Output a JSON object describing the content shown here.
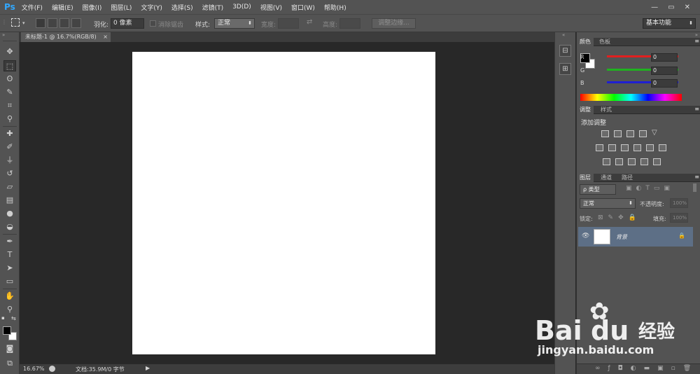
{
  "app": {
    "logo": "Ps"
  },
  "menu": [
    "文件(F)",
    "编辑(E)",
    "图像(I)",
    "图层(L)",
    "文字(Y)",
    "选择(S)",
    "滤镜(T)",
    "3D(D)",
    "视图(V)",
    "窗口(W)",
    "帮助(H)"
  ],
  "window_controls": {
    "minimize": "—",
    "restore": "▭",
    "close": "✕"
  },
  "options": {
    "feather_label": "羽化:",
    "feather_value": "0 像素",
    "antialias_label": "消除锯齿",
    "style_label": "样式:",
    "style_value": "正常",
    "width_label": "宽度:",
    "height_label": "高度:",
    "refine_edge": "调整边缘...",
    "workspace": "基本功能"
  },
  "document": {
    "tab_title": "未标题-1 @ 16.7%(RGB/8)",
    "close": "×"
  },
  "status": {
    "zoom": "16.67%",
    "doc_info": "文档:35.9M/0 字节"
  },
  "color_panel": {
    "tabs": [
      "颜色",
      "色板"
    ],
    "channels": [
      {
        "label": "R",
        "value": "0",
        "color": "#e21f1f"
      },
      {
        "label": "G",
        "value": "0",
        "color": "#1fb21f"
      },
      {
        "label": "B",
        "value": "0",
        "color": "#1f1fd2"
      }
    ],
    "foreground": "#000000",
    "background": "#ffffff"
  },
  "adjustments_panel": {
    "tabs": [
      "调整",
      "样式"
    ],
    "title": "添加调整"
  },
  "layers_panel": {
    "tabs": [
      "图层",
      "通道",
      "路径"
    ],
    "filter_kind": "ρ 类型",
    "blend_mode": "正常",
    "opacity_label": "不透明度:",
    "opacity_value": "100%",
    "lock_label": "锁定:",
    "fill_label": "填充:",
    "fill_value": "100%",
    "layers": [
      {
        "name": "背景",
        "locked": true,
        "visible": true
      }
    ]
  },
  "watermark": {
    "brand": "Bai",
    "brand2": "du",
    "cn": "经验",
    "url": "jingyan.baidu.com"
  }
}
